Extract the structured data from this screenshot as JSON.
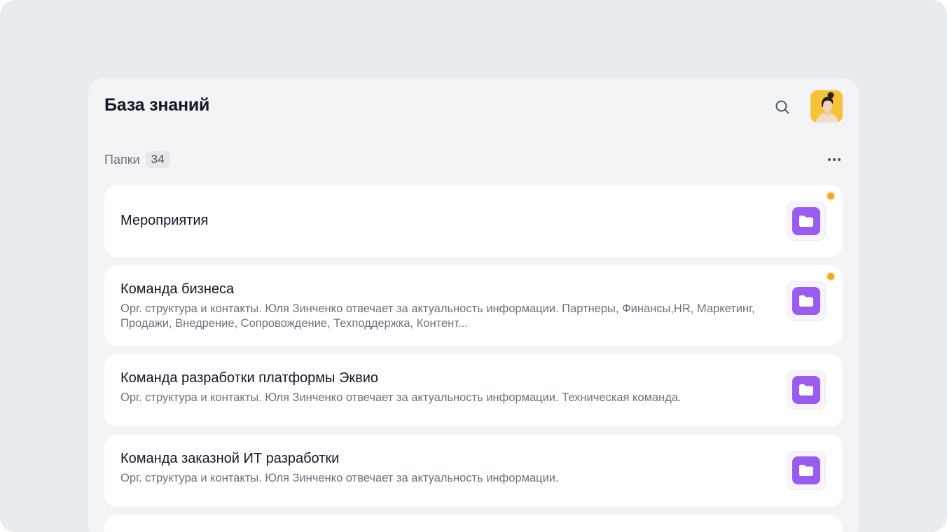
{
  "header": {
    "title": "База знаний",
    "search_icon": "search-icon",
    "avatar_icon": "user-avatar"
  },
  "folders": {
    "label": "Папки",
    "count": "34",
    "more_icon": "more-horizontal-icon"
  },
  "cards": [
    {
      "title": "Мероприятия",
      "description": "",
      "unread": true
    },
    {
      "title": "Команда бизнеса",
      "description": "Орг. структура и контакты. Юля Зинченко отвечает за актуальность информации. Партнеры, Финансы,HR, Маркетинг, Продажи, Внедрение, Сопровождение, Техподдержка, Контент...",
      "unread": true
    },
    {
      "title": "Команда разработки платформы Эквио",
      "description": "Орг. структура и контакты. Юля Зинченко отвечает за актуальность информации. Техническая команда.",
      "unread": false
    },
    {
      "title": "Команда заказной ИТ разработки",
      "description": "Орг. структура и контакты. Юля Зинченко отвечает за актуальность информации.",
      "unread": false
    }
  ],
  "colors": {
    "accent": "#9a5cf0",
    "unread_dot": "#f5a524",
    "background": "#e8ebef"
  }
}
